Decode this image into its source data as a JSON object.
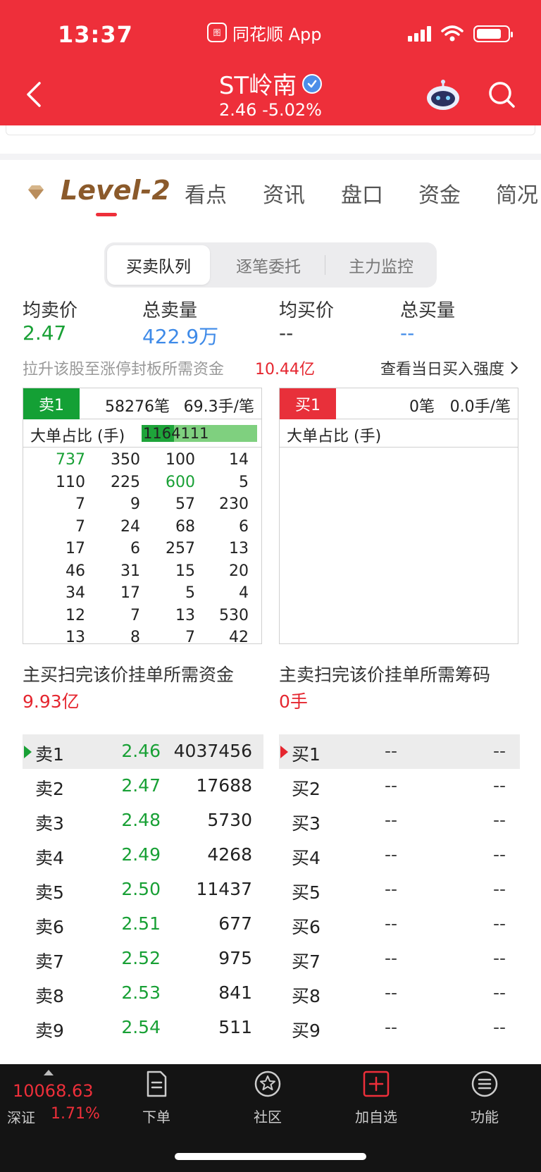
{
  "status_bar": {
    "time": "13:37",
    "source_app": "同花顺 App",
    "source_logo_text": "图"
  },
  "header": {
    "stock_name": "ST岭南",
    "price_line": "2.46 -5.02%",
    "icons": [
      "back-arrow-icon",
      "verified-icon",
      "robot-icon",
      "search-icon"
    ]
  },
  "tabs": {
    "items": [
      "Level-2",
      "看点",
      "资讯",
      "盘口",
      "资金",
      "简况"
    ],
    "active": "Level-2"
  },
  "segmented": {
    "items": [
      "买卖队列",
      "逐笔委托",
      "主力监控"
    ],
    "active": "买卖队列"
  },
  "summary": {
    "avg_sell_label": "均卖价",
    "avg_sell_value": "2.47",
    "total_sell_label": "总卖量",
    "total_sell_value": "422.9万",
    "avg_buy_label": "均买价",
    "avg_buy_value": "--",
    "total_buy_label": "总买量",
    "total_buy_value": "--"
  },
  "limit_info": {
    "text": "拉升该股至涨停封板所需资金",
    "amount": "10.44亿",
    "link": "查看当日买入强度"
  },
  "sell_queue": {
    "tag": "卖1",
    "count": "58276笔",
    "per_order": "69.3手/笔",
    "ratio_label": "大单占比 (手)",
    "ratio_value": "1164111",
    "ratio_fill": 0.28,
    "rows": [
      [
        "737",
        "350",
        "100",
        "14"
      ],
      [
        "110",
        "225",
        "600",
        "5"
      ],
      [
        "7",
        "9",
        "57",
        "230"
      ],
      [
        "7",
        "24",
        "68",
        "6"
      ],
      [
        "17",
        "6",
        "257",
        "13"
      ],
      [
        "46",
        "31",
        "15",
        "20"
      ],
      [
        "34",
        "17",
        "5",
        "4"
      ],
      [
        "12",
        "7",
        "13",
        "530"
      ],
      [
        "13",
        "8",
        "7",
        "42"
      ]
    ]
  },
  "buy_queue": {
    "tag": "买1",
    "count": "0笔",
    "per_order": "0.0手/笔",
    "ratio_label": "大单占比 (手)"
  },
  "capital": {
    "buy_sweep_label": "主买扫完该价挂单所需资金",
    "buy_sweep_value": "9.93亿",
    "sell_sweep_label": "主卖扫完该价挂单所需筹码",
    "sell_sweep_value": "0手"
  },
  "sell_book": [
    {
      "label": "卖1",
      "price": "2.46",
      "volume": "4037456"
    },
    {
      "label": "卖2",
      "price": "2.47",
      "volume": "17688"
    },
    {
      "label": "卖3",
      "price": "2.48",
      "volume": "5730"
    },
    {
      "label": "卖4",
      "price": "2.49",
      "volume": "4268"
    },
    {
      "label": "卖5",
      "price": "2.50",
      "volume": "11437"
    },
    {
      "label": "卖6",
      "price": "2.51",
      "volume": "677"
    },
    {
      "label": "卖7",
      "price": "2.52",
      "volume": "975"
    },
    {
      "label": "卖8",
      "price": "2.53",
      "volume": "841"
    },
    {
      "label": "卖9",
      "price": "2.54",
      "volume": "511"
    }
  ],
  "buy_book": [
    {
      "label": "买1",
      "price": "--",
      "volume": "--"
    },
    {
      "label": "买2",
      "price": "--",
      "volume": "--"
    },
    {
      "label": "买3",
      "price": "--",
      "volume": "--"
    },
    {
      "label": "买4",
      "price": "--",
      "volume": "--"
    },
    {
      "label": "买5",
      "price": "--",
      "volume": "--"
    },
    {
      "label": "买6",
      "price": "--",
      "volume": "--"
    },
    {
      "label": "买7",
      "price": "--",
      "volume": "--"
    },
    {
      "label": "买8",
      "price": "--",
      "volume": "--"
    },
    {
      "label": "买9",
      "price": "--",
      "volume": "--"
    }
  ],
  "bottom_bar": {
    "index_value": "10068.63",
    "index_name": "深证",
    "index_change": "1.71%",
    "nav": [
      {
        "label": "下单",
        "icon": "order-icon"
      },
      {
        "label": "社区",
        "icon": "community-icon"
      },
      {
        "label": "加自选",
        "icon": "add-watchlist-icon"
      },
      {
        "label": "功能",
        "icon": "menu-icon"
      }
    ]
  },
  "colors": {
    "brand_red": "#ee2f3a",
    "down_green": "#18a035",
    "level2_brown": "#8b5a2b",
    "blue": "#3e8ae8"
  }
}
